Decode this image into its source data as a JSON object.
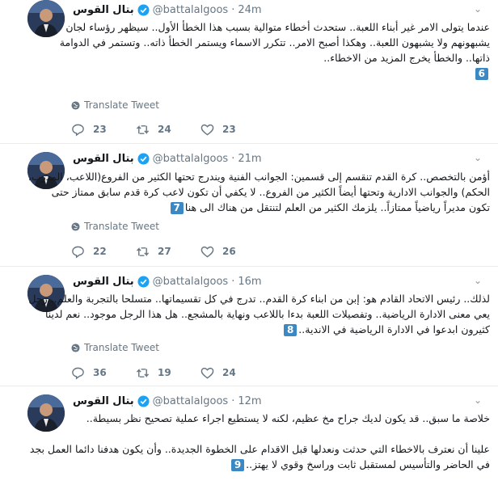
{
  "tweets": [
    {
      "author": "بتال القوس",
      "handle": "@battalalgoos",
      "time": "24m",
      "lines": [
        "عندما يتولى الامر غير أبناء اللعبة.. ستحدث أخطاء متوالية بسبب هذا الخطأ الأول.. سيظهر رؤساء لجان",
        "يشبهونهم ولا يشبهون اللعبة.. وهكذا أصبح الامر.. تتكرر الاسماء ويستمر الخطأ ذاته.. وتستمر في الدوامة",
        "ذاتها.. والخطأ يخرج المزيد من الاخطاء..",
        ""
      ],
      "badge": "6",
      "translate": "Translate Tweet",
      "replies": "23",
      "retweets": "24",
      "likes": "23"
    },
    {
      "author": "بتال القوس",
      "handle": "@battalalgoos",
      "time": "21m",
      "lines": [
        "أؤمن بالتخصص.. كرة القدم تنقسم إلى قسمين: الجوانب الفنية ويندرج تحتها الكثير من الفروع(اللاعب، المدرب،",
        "الحكم) والجوانب الادارية وتحتها أيضاً الكثير من الفروع.. لا يكفي أن تكون لاعب كرة قدم سابق ممتاز حتى",
        "تكون مديراً رياضياً ممتازاً.. يلزمك الكثير من العلم لتنتقل من هناك الى هنا"
      ],
      "badge": "7",
      "translate": "Translate Tweet",
      "replies": "22",
      "retweets": "27",
      "likes": "26"
    },
    {
      "author": "بتال القوس",
      "handle": "@battalalgoos",
      "time": "16m",
      "lines": [
        "لذلك.. رئيس الاتحاد القادم هو: إبن من ابناء كرة القدم.. تدرج في كل تقسيماتها.. متسلحا بالتجربة والعلم.. رجل",
        "يعي معنى الادارة الرياضية.. وتفصيلات اللعبة بدءا باللاعب ونهاية بالمشجع.. هل هذا الرجل موجود.. نعم لدينا",
        "كثيرون ابدعوا في الادارة الرياضية في الاندية.."
      ],
      "badge": "8",
      "translate": "Translate Tweet",
      "replies": "36",
      "retweets": "19",
      "likes": "24"
    },
    {
      "author": "بتال القوس",
      "handle": "@battalalgoos",
      "time": "12m",
      "lines": [
        "خلاصة ما سبق.. قد يكون لديك جراح مخ عظيم، لكنه لا يستطيع اجراء عملية تصحيح نظر بسيطة..",
        "",
        "علينا أن نعترف بالاخطاء التي حدثت ونعدلها قبل الاقدام على الخطوة الجديدة.. وأن يكون هدفنا دائما العمل بجد",
        "في الحاضر والتأسيس لمستقبل ثابت وراسخ وقوي لا يهتز.."
      ],
      "badge": "9"
    }
  ],
  "colors": {
    "badge": "#3b88c3",
    "verified": "#1da1f2",
    "muted": "#657786"
  },
  "icons": [
    "verified-badge-icon",
    "chevron-down-icon",
    "globe-icon",
    "reply-icon",
    "retweet-icon",
    "like-icon"
  ]
}
